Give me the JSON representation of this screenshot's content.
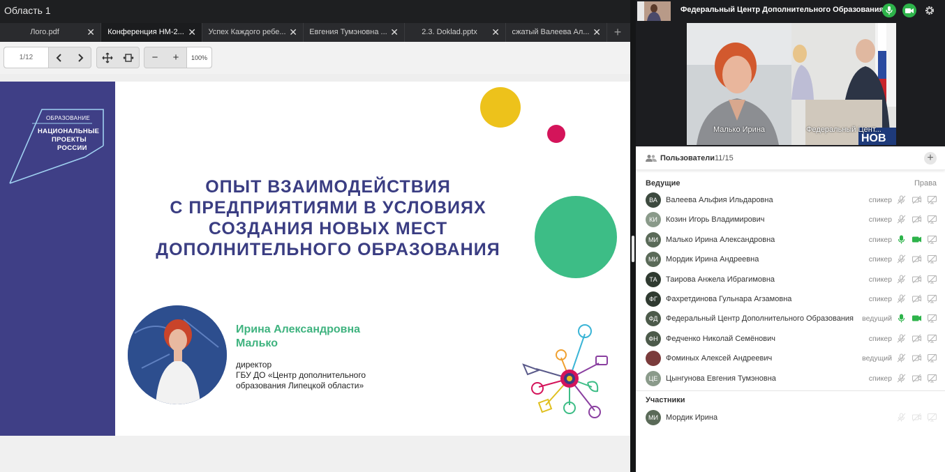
{
  "area": {
    "title": "Область 1"
  },
  "tabs": [
    {
      "label": "Лого.pdf",
      "active": false
    },
    {
      "label": "Конференция НМ-2...",
      "active": true
    },
    {
      "label": "Успех Каждого ребе...",
      "active": false
    },
    {
      "label": "Евгения Тумэновна ...",
      "active": false
    },
    {
      "label": "2.3. Doklad.pptx",
      "active": false
    },
    {
      "label": "сжатый Валеева Ал...",
      "active": false
    }
  ],
  "toolbar": {
    "page": "1/12",
    "zoom": "100%"
  },
  "slide": {
    "logo_top": "ОБРАЗОВАНИЕ",
    "logo_line1": "НАЦИОНАЛЬНЫЕ",
    "logo_line2": "ПРОЕКТЫ",
    "logo_line3": "РОССИИ",
    "title_lines": [
      "ОПЫТ ВЗАИМОДЕЙСТВИЯ",
      "С ПРЕДПРИЯТИЯМИ В УСЛОВИЯХ",
      "СОЗДАНИЯ НОВЫХ МЕСТ",
      "ДОПОЛНИТЕЛЬНОГО ОБРАЗОВАНИЯ"
    ],
    "person_name_line1": "Ирина Александровна",
    "person_name_line2": "Малько",
    "person_info_lines": [
      "директор",
      "ГБУ ДО «Центр дополнительного",
      "образования Липецкой области»"
    ],
    "colors": {
      "sidebar": "#3f3f86",
      "yellow": "#edc21b",
      "red": "#d4145a",
      "green": "#3dbd86",
      "title": "#3a3d82"
    }
  },
  "conference": {
    "title": "Федеральный Центр Дополнительного Образования",
    "videos": [
      {
        "name": "Малько Ирина"
      },
      {
        "name": "Федеральный Цент..."
      }
    ]
  },
  "users": {
    "title": "Пользователи",
    "count": "11/15",
    "hosts_label": "Ведущие",
    "rights_label": "Права",
    "participants_label": "Участники",
    "hosts": [
      {
        "initials": "ВА",
        "name": "Валеева Альфия Ильдаровна",
        "role": "спикер",
        "mic_on": false,
        "cam_on": false,
        "avatar_color": "#3d4a3f"
      },
      {
        "initials": "КИ",
        "name": "Козин Игорь Владимирович",
        "role": "спикер",
        "mic_on": false,
        "cam_on": false,
        "avatar_color": "#8a9a8a"
      },
      {
        "initials": "МИ",
        "name": "Малько Ирина Александровна",
        "role": "спикер",
        "mic_on": true,
        "cam_on": true,
        "avatar_color": "#5a6a58"
      },
      {
        "initials": "МИ",
        "name": "Мордик Ирина Андреевна",
        "role": "спикер",
        "mic_on": false,
        "cam_on": false,
        "avatar_color": "#5a6a58"
      },
      {
        "initials": "ТА",
        "name": "Таирова Анжела Ибрагимовна",
        "role": "спикер",
        "mic_on": false,
        "cam_on": false,
        "avatar_color": "#2f3a30"
      },
      {
        "initials": "ФГ",
        "name": "Фахретдинова Гульнара Агзамовна",
        "role": "спикер",
        "mic_on": false,
        "cam_on": false,
        "avatar_color": "#2f3a30"
      },
      {
        "initials": "ФД",
        "name": "Федеральный Центр Дополнительного Образования",
        "role": "ведущий",
        "mic_on": true,
        "cam_on": true,
        "avatar_color": "#4c5a4a"
      },
      {
        "initials": "ФН",
        "name": "Федченко Николай Семёнович",
        "role": "спикер",
        "mic_on": false,
        "cam_on": false,
        "avatar_color": "#4c5a4a"
      },
      {
        "initials": "",
        "name": "Фоминых Алексей Андреевич",
        "role": "ведущий",
        "mic_on": false,
        "cam_on": false,
        "avatar_color": "#7a3b3b"
      },
      {
        "initials": "ЦЕ",
        "name": "Цынгунова Евгения Тумэновна",
        "role": "спикер",
        "mic_on": false,
        "cam_on": false,
        "avatar_color": "#8a9a8a"
      }
    ],
    "participants": [
      {
        "initials": "МИ",
        "name": "Мордик Ирина",
        "role": "",
        "mic_on": false,
        "cam_on": false,
        "avatar_color": "#5a6a58"
      }
    ]
  }
}
